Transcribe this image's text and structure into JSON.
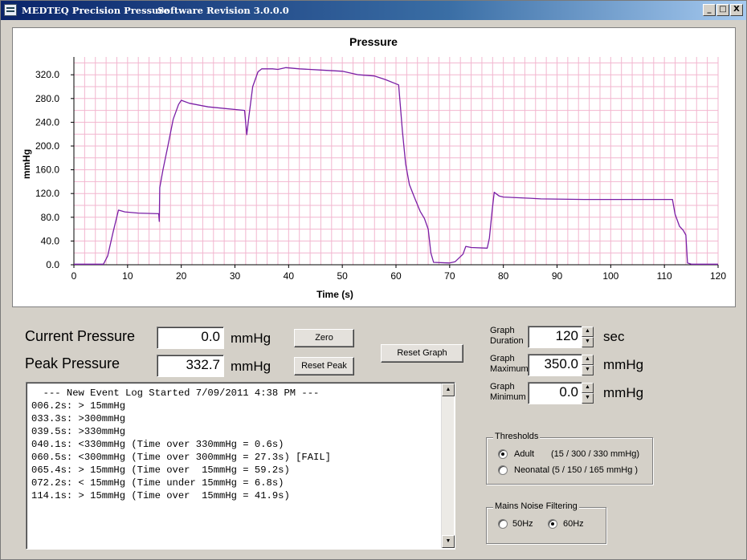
{
  "window": {
    "app_title": "MEDTEQ Precision Pressure",
    "revision": "Software Revision 3.0.0.0",
    "min_label": "_",
    "max_label": "□",
    "close_label": "X"
  },
  "chart_data": {
    "type": "line",
    "title": "Pressure",
    "xlabel": "Time (s)",
    "ylabel": "mmHg",
    "xlim": [
      0,
      120
    ],
    "ylim": [
      0,
      350
    ],
    "x_ticks": [
      0,
      10,
      20,
      30,
      40,
      50,
      60,
      70,
      80,
      90,
      100,
      110,
      120
    ],
    "y_ticks": [
      0,
      40,
      80,
      120,
      160,
      200,
      240,
      280,
      320
    ],
    "y_tick_labels": [
      "0.0",
      "40.0",
      "80.0",
      "120.0",
      "160.0",
      "200.0",
      "240.0",
      "280.0",
      "320.0"
    ],
    "minor_x_step": 2,
    "minor_y_step": 20,
    "grid": true,
    "line_color": "#7a1fa6",
    "grid_color": "#f2b6cf",
    "series": [
      {
        "points": [
          [
            0,
            1
          ],
          [
            5.5,
            1
          ],
          [
            6.3,
            15
          ],
          [
            7.3,
            55
          ],
          [
            8.3,
            92
          ],
          [
            9.5,
            89
          ],
          [
            12,
            87
          ],
          [
            15.8,
            86
          ],
          [
            15.9,
            73
          ],
          [
            16.0,
            130
          ],
          [
            16.6,
            160
          ],
          [
            17.5,
            200
          ],
          [
            18.5,
            245
          ],
          [
            19.5,
            270
          ],
          [
            20,
            277
          ],
          [
            21.5,
            272
          ],
          [
            25,
            266
          ],
          [
            31.8,
            260
          ],
          [
            32.2,
            219
          ],
          [
            32.6,
            250
          ],
          [
            33.3,
            300
          ],
          [
            34.3,
            325
          ],
          [
            35,
            330
          ],
          [
            37,
            330
          ],
          [
            38,
            329
          ],
          [
            39.5,
            332
          ],
          [
            42,
            330
          ],
          [
            46,
            328
          ],
          [
            50,
            326
          ],
          [
            53,
            320
          ],
          [
            56,
            318
          ],
          [
            58,
            312
          ],
          [
            60.5,
            303
          ],
          [
            61.2,
            225
          ],
          [
            61.8,
            170
          ],
          [
            62.5,
            135
          ],
          [
            63.5,
            112
          ],
          [
            64.5,
            90
          ],
          [
            65.3,
            78
          ],
          [
            66,
            60
          ],
          [
            66.5,
            20
          ],
          [
            67,
            4
          ],
          [
            70,
            3
          ],
          [
            71,
            5
          ],
          [
            72.5,
            18
          ],
          [
            73,
            31
          ],
          [
            74,
            29
          ],
          [
            77,
            28
          ],
          [
            77.4,
            45
          ],
          [
            77.9,
            90
          ],
          [
            78.3,
            122
          ],
          [
            79.2,
            116
          ],
          [
            80,
            114
          ],
          [
            85,
            112
          ],
          [
            87,
            111
          ],
          [
            95,
            110
          ],
          [
            111.5,
            110
          ],
          [
            112,
            85
          ],
          [
            112.8,
            65
          ],
          [
            113.5,
            58
          ],
          [
            114,
            50
          ],
          [
            114.3,
            3
          ],
          [
            115,
            1
          ],
          [
            120,
            1
          ]
        ]
      }
    ]
  },
  "controls": {
    "current_label": "Current Pressure",
    "current_value": "0.0",
    "peak_label": "Peak Pressure",
    "peak_value": "332.7",
    "unit_mmhg": "mmHg",
    "zero_button": "Zero",
    "reset_peak_button": "Reset Peak",
    "reset_graph_button": "Reset Graph"
  },
  "graph_settings": {
    "duration_label_1": "Graph",
    "duration_label_2": "Duration",
    "duration_value": "120",
    "duration_unit": "sec",
    "maximum_label_1": "Graph",
    "maximum_label_2": "Maximum",
    "maximum_value": "350.0",
    "maximum_unit": "mmHg",
    "minimum_label_1": "Graph",
    "minimum_label_2": "Minimum",
    "minimum_value": "0.0",
    "minimum_unit": "mmHg",
    "spin_up": "▲",
    "spin_down": "▼"
  },
  "event_log": {
    "lines": [
      "  --- New Event Log Started 7/09/2011 4:38 PM ---",
      "006.2s: > 15mmHg",
      "033.3s: >300mmHg",
      "039.5s: >330mmHg",
      "040.1s: <330mmHg (Time over 330mmHg = 0.6s)",
      "060.5s: <300mmHg (Time over 300mmHg = 27.3s) [FAIL]",
      "065.4s: > 15mmHg (Time over  15mmHg = 59.2s)",
      "072.2s: < 15mmHg (Time under 15mmHg = 6.8s)",
      "114.1s: > 15mmHg (Time over  15mmHg = 41.9s)"
    ],
    "scroll_up": "▲",
    "scroll_down": "▼"
  },
  "thresholds": {
    "title": "Thresholds",
    "adult_label": "Adult",
    "adult_values": "(15 / 300 / 330 mmHg)",
    "neonatal_label": "Neonatal (5 / 150 / 165 mmHg )",
    "selected": "adult"
  },
  "mains_filter": {
    "title": "Mains Noise Filtering",
    "opt_50": "50Hz",
    "opt_60": "60Hz",
    "selected": "60Hz"
  }
}
